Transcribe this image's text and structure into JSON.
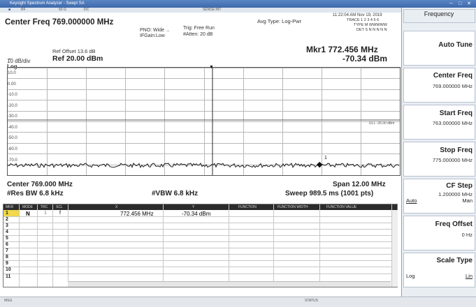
{
  "window": {
    "title": "Keysight Spectrum Analyzer - Swept SA"
  },
  "menubar": {
    "items": [
      "RF",
      "50 Ω",
      "DC"
    ],
    "right_item": "SENSE:INT"
  },
  "header": {
    "center_freq": "Center Freq 769.000000 MHz",
    "pno": "PNO: Wide",
    "ifgain": "IFGain:Low",
    "trig": "Trig: Free Run",
    "atten": "#Atten: 20 dB",
    "avg_type": "Avg Type: Log-Pwr",
    "timestamp": "11:22:04 AM Nov 19, 2019",
    "trace_row": "TRACE 1 2 3 4 5 6",
    "type_row": "TYPE M WWWWW",
    "det_row": "DET S N N N N N",
    "scale": "10 dB/div",
    "log": "Log",
    "ref_offset": "Ref Offset 13.6 dB",
    "ref_level": "Ref 20.00 dBm",
    "marker_freq": "Mkr1 772.456 MHz",
    "marker_amp": "-70.34 dBm"
  },
  "plot": {
    "y_ticks": [
      "10.0",
      "0.00",
      "-10.0",
      "-20.0",
      "-30.0",
      "-40.0",
      "-50.0",
      "-60.0",
      "-70.0"
    ],
    "line_label": "DL1 -35.00 dBm",
    "marker_label": "1"
  },
  "footer": {
    "center": "Center 769.000 MHz",
    "res_bw": "#Res BW 6.8 kHz",
    "vbw": "#VBW 6.8 kHz",
    "span": "Span 12.00 MHz",
    "sweep": "Sweep  989.5 ms (1001 pts)"
  },
  "marker_table": {
    "headers": [
      "MKR",
      "MODE",
      "TRC",
      "SCL",
      "X",
      "Y",
      "FUNCTION",
      "FUNCTION WIDTH",
      "FUNCTION VALUE"
    ],
    "row1": {
      "num": "1",
      "mode": "N",
      "trc": "1",
      "scl": "f",
      "x": "772.456 MHz",
      "y": "-70.34 dBm"
    },
    "row_numbers": [
      "2",
      "3",
      "4",
      "5",
      "6",
      "7",
      "8",
      "9",
      "10",
      "11"
    ]
  },
  "softkeys": {
    "menu_title": "Frequency",
    "keys": [
      {
        "label": "Auto Tune",
        "value": ""
      },
      {
        "label": "Center Freq",
        "value": "769.000000 MHz"
      },
      {
        "label": "Start Freq",
        "value": "763.000000 MHz"
      },
      {
        "label": "Stop Freq",
        "value": "775.000000 MHz"
      },
      {
        "label": "CF Step",
        "value": "1.200000 MHz",
        "left_opt": "Auto",
        "right_opt": "Man"
      },
      {
        "label": "Freq Offset",
        "value": "0 Hz"
      },
      {
        "label": "Scale Type",
        "left_opt": "Log",
        "right_opt": "Lin"
      }
    ]
  },
  "status": {
    "left": "MSG",
    "right": "STATUS"
  }
}
